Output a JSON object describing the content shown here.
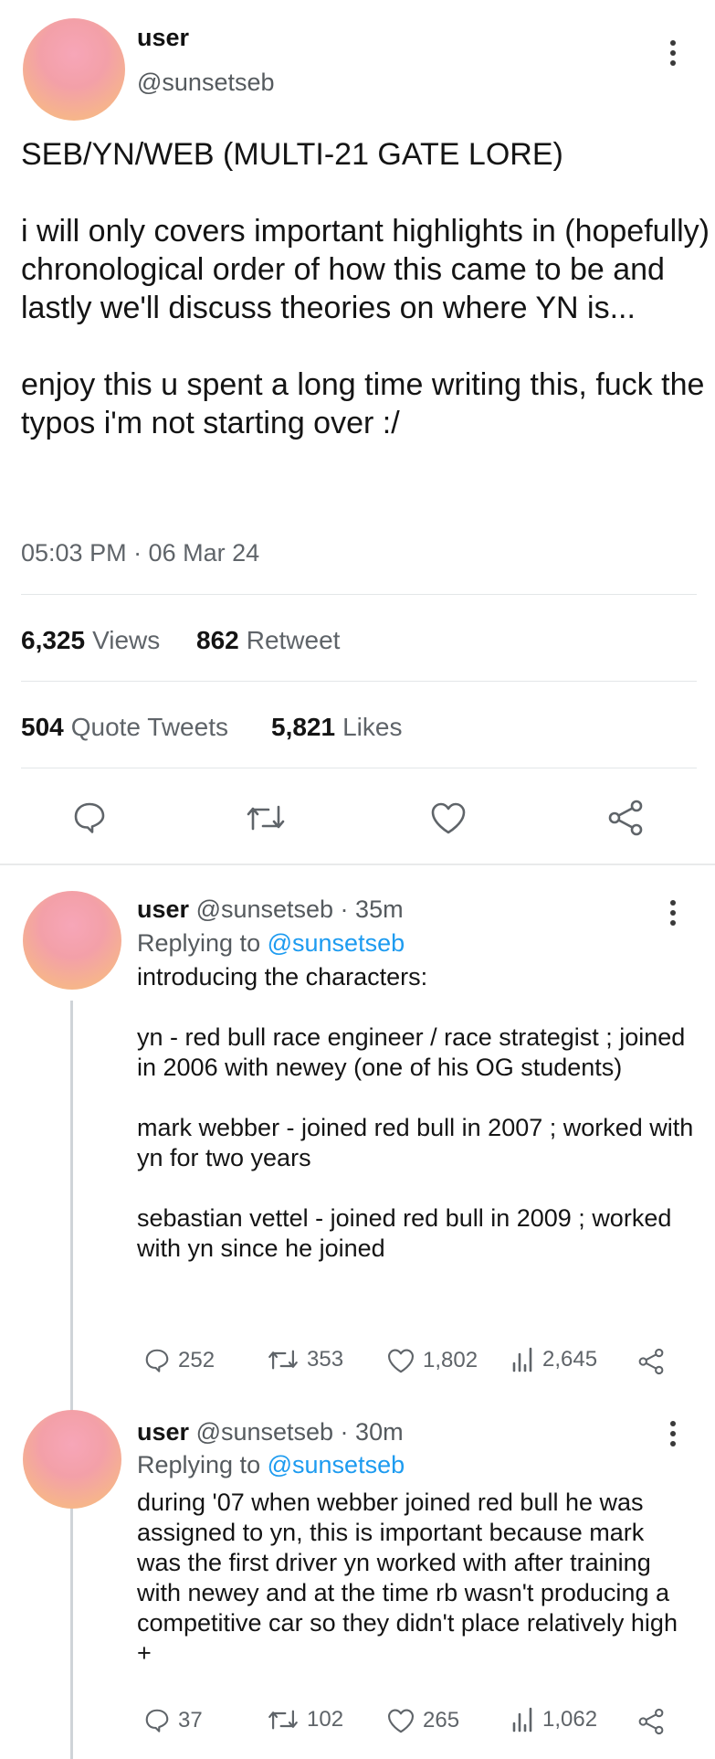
{
  "main_tweet": {
    "user": "user",
    "handle": "@sunsetseb",
    "paragraphs": [
      "SEB/YN/WEB (MULTI-21 GATE LORE)",
      "i will only covers important highlights in (hopefully) chronological order of how this came to be and lastly we'll discuss theories on where YN is...",
      "enjoy this u spent a long time writing this, fuck the typos i'm not starting over :/"
    ],
    "timestamp": "05:03 PM · 06 Mar 24",
    "views_count": "6,325",
    "views_label": "Views",
    "retweet_count": "862",
    "retweet_label": "Retweet",
    "quote_count": "504",
    "quote_label": "Quote Tweets",
    "likes_count": "5,821",
    "likes_label": "Likes",
    "actions": [
      "reply-icon",
      "retweet-icon",
      "like-icon",
      "share-icon"
    ]
  },
  "replies": [
    {
      "user": "user",
      "handle_time": "@sunsetseb · 35m",
      "replying_prefix": "Replying to",
      "replying_to": "@sunsetseb",
      "paragraphs": [
        "introducing the characters:",
        "yn - red bull race engineer / race strategist ; joined in 2006 with newey (one of his OG students)",
        "mark webber - joined red bull in 2007 ; worked with yn for two years",
        "sebastian vettel - joined red bull in 2009 ; worked with yn since he joined"
      ],
      "replies": "252",
      "retweets": "353",
      "likes": "1,802",
      "views": "2,645"
    },
    {
      "user": "user",
      "handle_time": "@sunsetseb · 30m",
      "replying_prefix": "Replying to",
      "replying_to": "@sunsetseb",
      "paragraphs": [
        "during '07 when webber joined red bull he was assigned to yn, this is important because mark was the first driver yn worked with after training with newey and at the time rb wasn't producing a competitive car so they didn't place relatively high +"
      ],
      "replies": "37",
      "retweets": "102",
      "likes": "265",
      "views": "1,062"
    }
  ],
  "colors": {
    "link": "#1d9bf0",
    "muted": "#5f6469",
    "text": "#141414"
  }
}
